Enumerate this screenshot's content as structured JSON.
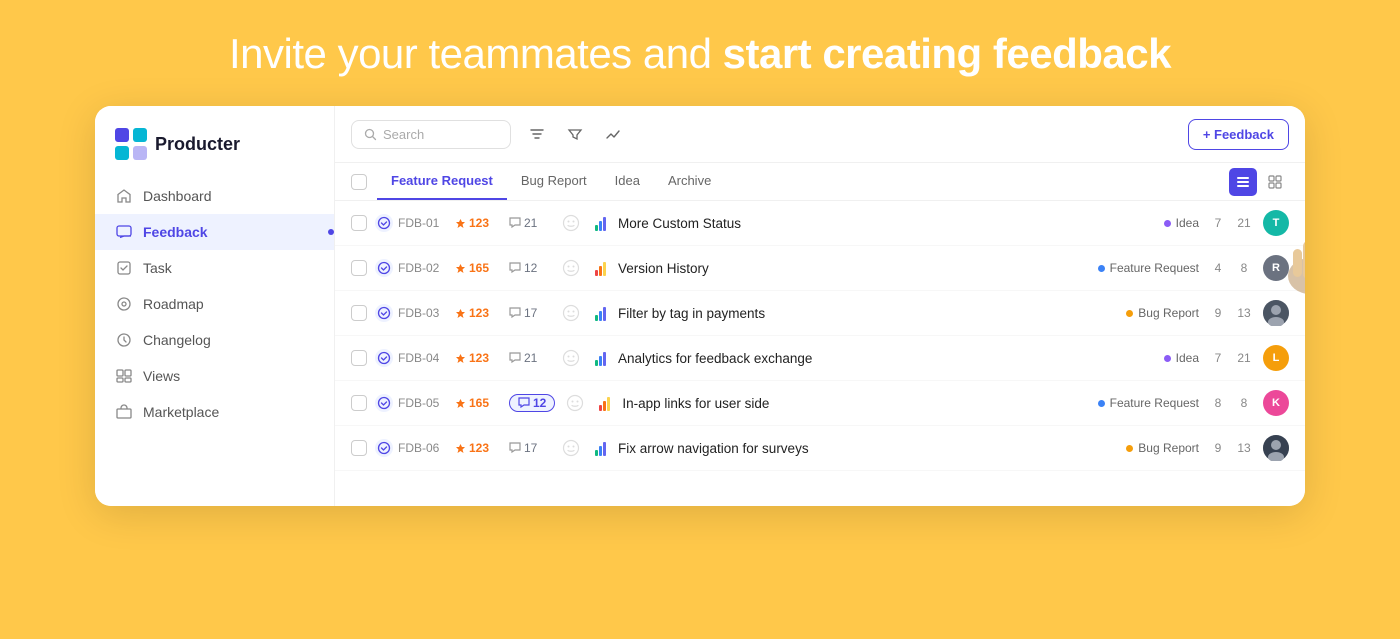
{
  "hero": {
    "text_normal": "Invite your teammates and ",
    "text_bold": "start creating feedback"
  },
  "app": {
    "logo_text": "Producter"
  },
  "sidebar": {
    "items": [
      {
        "id": "dashboard",
        "label": "Dashboard",
        "icon": "home-icon"
      },
      {
        "id": "feedback",
        "label": "Feedback",
        "icon": "feedback-icon",
        "active": true
      },
      {
        "id": "task",
        "label": "Task",
        "icon": "task-icon"
      },
      {
        "id": "roadmap",
        "label": "Roadmap",
        "icon": "roadmap-icon"
      },
      {
        "id": "changelog",
        "label": "Changelog",
        "icon": "changelog-icon"
      },
      {
        "id": "views",
        "label": "Views",
        "icon": "views-icon"
      },
      {
        "id": "marketplace",
        "label": "Marketplace",
        "icon": "marketplace-icon"
      }
    ]
  },
  "toolbar": {
    "search_placeholder": "Search",
    "feedback_btn": "+ Feedback"
  },
  "tabs": {
    "items": [
      {
        "id": "feature-request",
        "label": "Feature Request",
        "active": true
      },
      {
        "id": "bug-report",
        "label": "Bug Report",
        "active": false
      },
      {
        "id": "idea",
        "label": "Idea",
        "active": false
      },
      {
        "id": "archive",
        "label": "Archive",
        "active": false
      }
    ]
  },
  "rows": [
    {
      "id": "FDB-01",
      "votes": "123",
      "comments": "21",
      "highlighted_comment": false,
      "title": "More Custom Status",
      "tag": "Idea",
      "tag_color": "#8B5CF6",
      "count1": "7",
      "count2": "21",
      "avatar_text": "T",
      "avatar_color": "#14B8A6",
      "chart_colors": [
        "#10B981",
        "#3B82F6",
        "#6366F1"
      ]
    },
    {
      "id": "FDB-02",
      "votes": "165",
      "comments": "12",
      "highlighted_comment": false,
      "title": "Version History",
      "tag": "Feature Request",
      "tag_color": "#3B82F6",
      "count1": "4",
      "count2": "8",
      "avatar_text": "R",
      "avatar_color": "#6B7280",
      "chart_colors": [
        "#EF4444",
        "#F97316",
        "#FCD34D"
      ]
    },
    {
      "id": "FDB-03",
      "votes": "123",
      "comments": "17",
      "highlighted_comment": false,
      "title": "Filter by tag in payments",
      "tag": "Bug Report",
      "tag_color": "#F59E0B",
      "count1": "9",
      "count2": "13",
      "avatar_text": "",
      "avatar_color": "#9CA3AF",
      "avatar_img": true,
      "chart_colors": [
        "#10B981",
        "#3B82F6",
        "#6366F1"
      ]
    },
    {
      "id": "FDB-04",
      "votes": "123",
      "comments": "21",
      "highlighted_comment": false,
      "title": "Analytics for feedback exchange",
      "tag": "Idea",
      "tag_color": "#8B5CF6",
      "count1": "7",
      "count2": "21",
      "avatar_text": "L",
      "avatar_color": "#F59E0B",
      "chart_colors": [
        "#10B981",
        "#3B82F6",
        "#6366F1"
      ]
    },
    {
      "id": "FDB-05",
      "votes": "165",
      "comments": "12",
      "highlighted_comment": true,
      "title": "In-app links for user side",
      "tag": "Feature Request",
      "tag_color": "#3B82F6",
      "count1": "8",
      "count2": "8",
      "avatar_text": "K",
      "avatar_color": "#EC4899",
      "chart_colors": [
        "#EF4444",
        "#F97316",
        "#FCD34D"
      ]
    },
    {
      "id": "FDB-06",
      "votes": "123",
      "comments": "17",
      "highlighted_comment": false,
      "title": "Fix arrow navigation for surveys",
      "tag": "Bug Report",
      "tag_color": "#F59E0B",
      "count1": "9",
      "count2": "13",
      "avatar_text": "",
      "avatar_color": "#9CA3AF",
      "avatar_img2": true,
      "chart_colors": [
        "#10B981",
        "#3B82F6",
        "#6366F1"
      ]
    }
  ]
}
